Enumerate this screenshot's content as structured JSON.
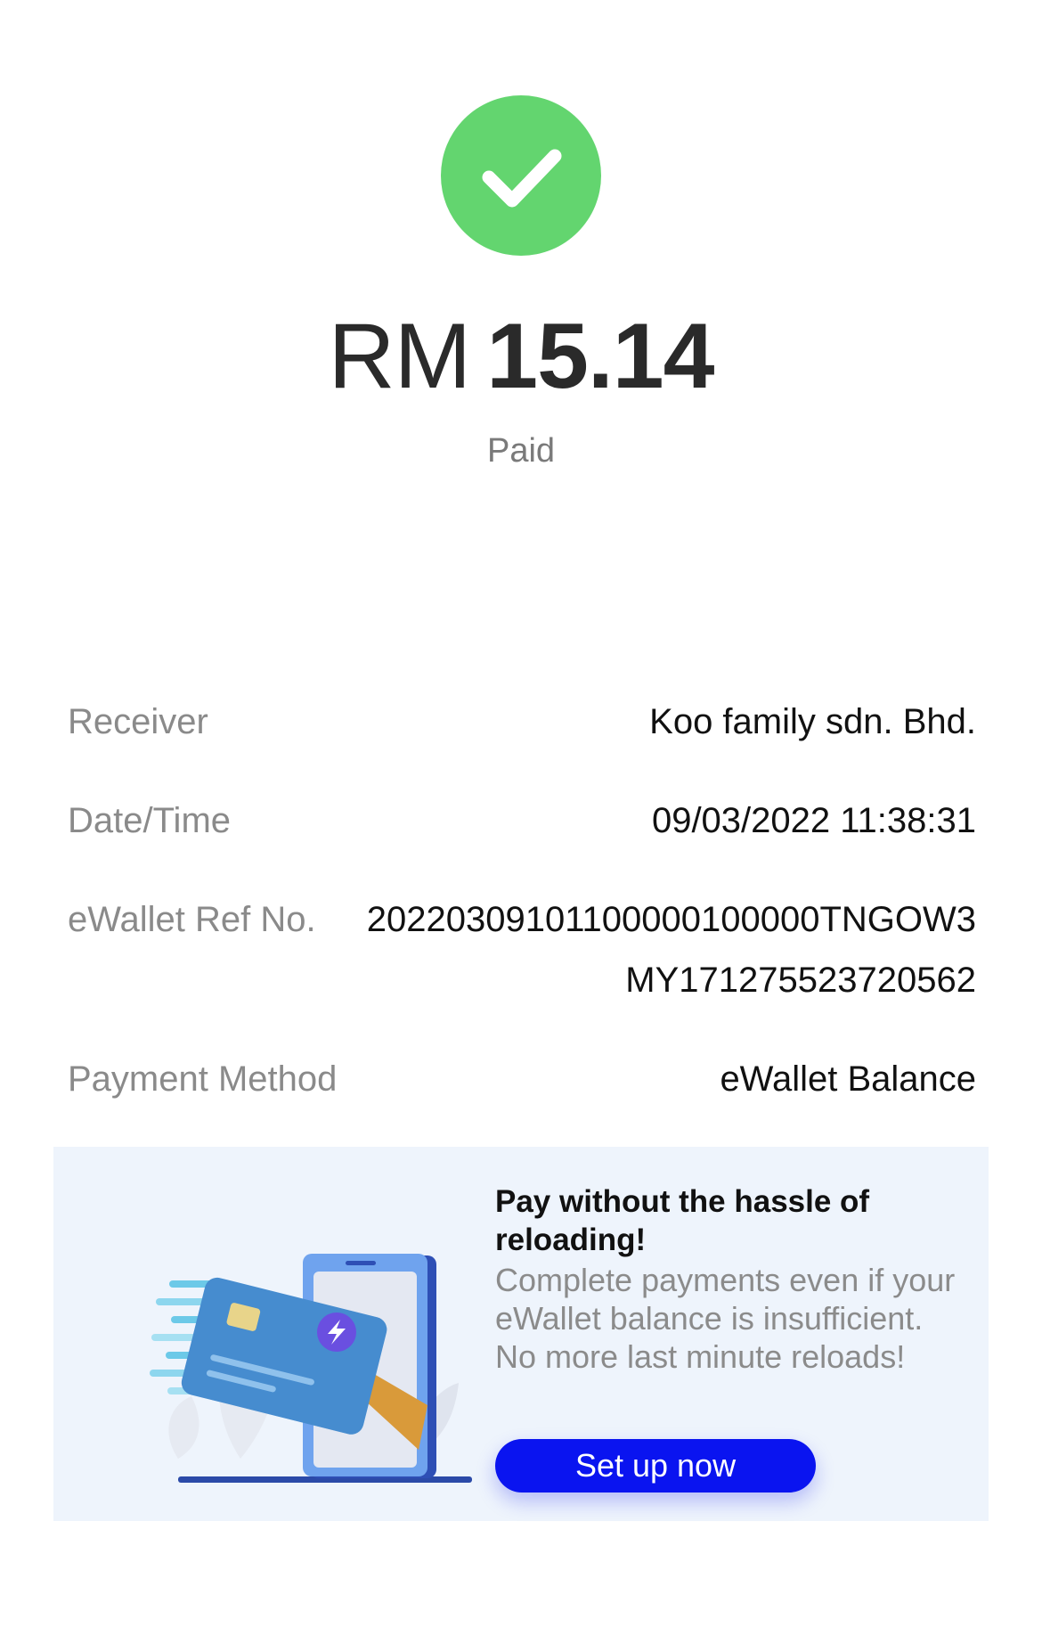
{
  "status": {
    "icon": "check-icon",
    "color": "#63d56f",
    "currency": "RM",
    "amount": "15.14",
    "label": "Paid"
  },
  "details": [
    {
      "label": "Receiver",
      "value": "Koo family sdn. Bhd."
    },
    {
      "label": "Date/Time",
      "value": "09/03/2022 11:38:31"
    },
    {
      "label": "eWallet Ref No.",
      "value": "20220309101100000100000TNGOW3MY171275523720562"
    },
    {
      "label": "Payment Method",
      "value": "eWallet Balance"
    }
  ],
  "banner": {
    "illustration": "card-payment-illustration",
    "title": "Pay without the hassle of reloading!",
    "description": "Complete payments even if your eWallet balance is insufficient. No more last minute reloads!",
    "button_label": "Set up now",
    "button_color": "#0a14f0"
  }
}
